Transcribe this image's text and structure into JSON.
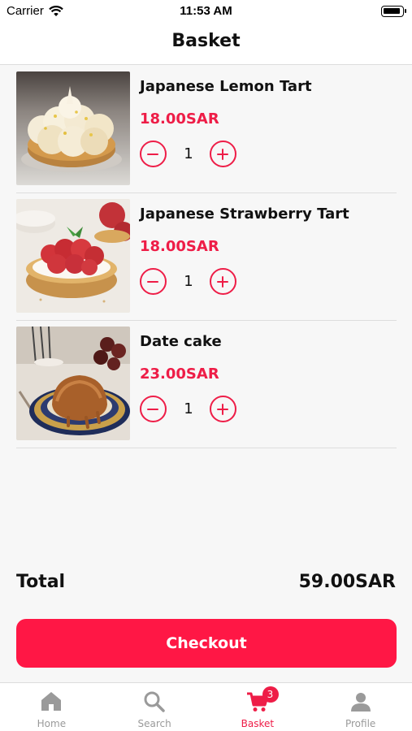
{
  "status_bar": {
    "carrier": "Carrier",
    "time": "11:53 AM"
  },
  "header": {
    "title": "Basket"
  },
  "items": [
    {
      "name": "Japanese Lemon Tart",
      "price": "18.00SAR",
      "quantity": "1",
      "image": "lemon-meringue-tart"
    },
    {
      "name": "Japanese Strawberry Tart",
      "price": "18.00SAR",
      "quantity": "1",
      "image": "strawberry-tart"
    },
    {
      "name": "Date cake",
      "price": "23.00SAR",
      "quantity": "1",
      "image": "date-cake"
    }
  ],
  "summary": {
    "total_label": "Total",
    "total_value": "59.00SAR"
  },
  "checkout": {
    "label": "Checkout"
  },
  "tab_bar": {
    "tabs": [
      {
        "label": "Home",
        "icon": "home-icon",
        "active": false
      },
      {
        "label": "Search",
        "icon": "search-icon",
        "active": false
      },
      {
        "label": "Basket",
        "icon": "cart-icon",
        "active": true,
        "badge": "3"
      },
      {
        "label": "Profile",
        "icon": "person-icon",
        "active": false
      }
    ]
  },
  "colors": {
    "accent": "#ee1d47",
    "checkout_bg": "#ff1745",
    "background": "#f7f7f7",
    "tab_inactive": "#9a9a9a"
  }
}
